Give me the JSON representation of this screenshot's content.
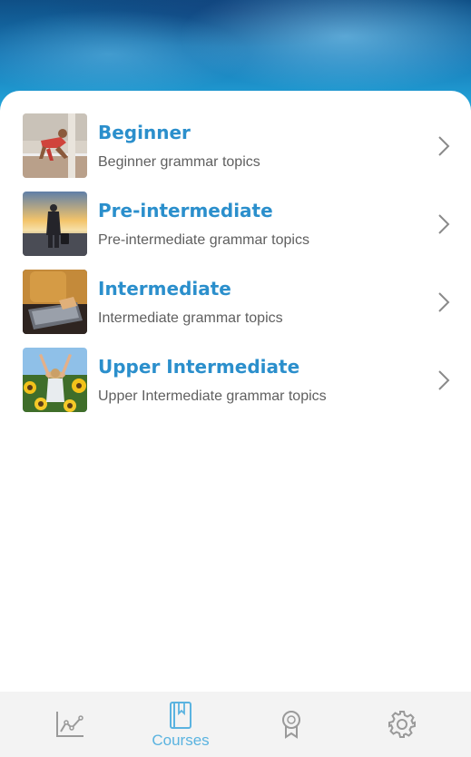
{
  "courses": [
    {
      "title": "Beginner",
      "subtitle": "Beginner grammar topics",
      "image": "sprinter-start-photo"
    },
    {
      "title": "Pre-intermediate",
      "subtitle": "Pre-intermediate grammar topics",
      "image": "traveler-sunset-photo"
    },
    {
      "title": "Intermediate",
      "subtitle": "Intermediate grammar topics",
      "image": "laptop-typing-photo"
    },
    {
      "title": "Upper Intermediate",
      "subtitle": "Upper Intermediate grammar topics",
      "image": "sunflower-field-photo"
    }
  ],
  "tabbar": {
    "tabs": [
      {
        "icon": "chart-line-icon",
        "label": "",
        "active": false
      },
      {
        "icon": "book-icon",
        "label": "Courses",
        "active": true
      },
      {
        "icon": "award-ribbon-icon",
        "label": "",
        "active": false
      },
      {
        "icon": "gear-icon",
        "label": "",
        "active": false
      }
    ]
  },
  "colors": {
    "title": "#2b8fcc",
    "subtitle": "#5f5f5f",
    "tab_active": "#5ab3e0",
    "tab_inactive": "#9a9a9a",
    "chevron": "#8a8a8a",
    "tabbar_bg": "#f3f3f3"
  }
}
